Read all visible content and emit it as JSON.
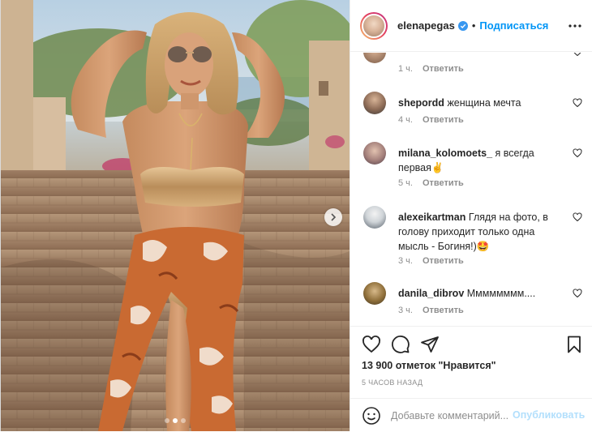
{
  "header": {
    "username": "elenapegas",
    "follow_label": "Подписаться",
    "dot": "•"
  },
  "comments": [
    {
      "username": "",
      "text": "",
      "time": "1 ч.",
      "reply_label": "Ответить"
    },
    {
      "username": "shepordd",
      "text": "женщина мечта",
      "time": "4 ч.",
      "reply_label": "Ответить"
    },
    {
      "username": "milana_kolomoets_",
      "text": "я всегда первая✌️",
      "time": "5 ч.",
      "reply_label": "Ответить"
    },
    {
      "username": "alexeikartman",
      "text": "Глядя на фото, в голову приходит только одна мысль - Богиня!)🤩",
      "time": "3 ч.",
      "reply_label": "Ответить"
    },
    {
      "username": "danila_dibrov",
      "text": "Мммммммм....",
      "time": "3 ч.",
      "reply_label": "Ответить"
    }
  ],
  "actions": {
    "likes_text": "13 900 отметок \"Нравится\"",
    "time_text": "5 часов назад"
  },
  "add_comment": {
    "placeholder": "Добавьте комментарий...",
    "publish_label": "Опубликовать"
  },
  "carousel": {
    "slide_count": 3,
    "active_index": 1
  },
  "colors": {
    "accent": "#0095f6",
    "publish_disabled": "#b2dffc",
    "muted": "#8e8e8e",
    "text": "#262626",
    "divider": "#efefef"
  },
  "icons": {
    "header_verified": "verified-badge-icon",
    "header_more": "more-horizontal-icon",
    "comment_like": "heart-outline-icon",
    "like": "heart-outline-icon",
    "comment": "speech-bubble-icon",
    "share": "paper-plane-icon",
    "save": "bookmark-icon",
    "emoji": "smiley-icon",
    "carousel_next": "chevron-right-icon"
  }
}
